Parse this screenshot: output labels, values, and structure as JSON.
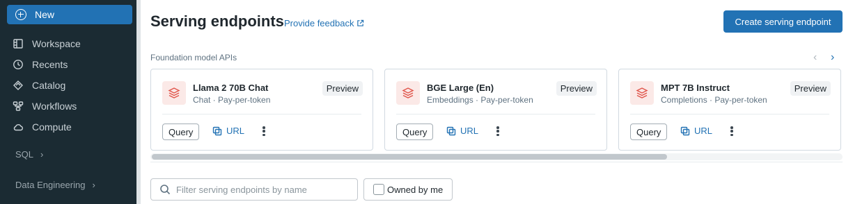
{
  "sidebar": {
    "new_label": "New",
    "items": [
      {
        "label": "Workspace",
        "icon": "workspace-icon"
      },
      {
        "label": "Recents",
        "icon": "clock-icon"
      },
      {
        "label": "Catalog",
        "icon": "catalog-icon"
      },
      {
        "label": "Workflows",
        "icon": "workflows-icon"
      },
      {
        "label": "Compute",
        "icon": "cloud-icon"
      }
    ],
    "sections": [
      {
        "label": "SQL"
      },
      {
        "label": "Data Engineering"
      }
    ]
  },
  "header": {
    "title": "Serving endpoints",
    "feedback_label": "Provide feedback",
    "create_label": "Create serving endpoint"
  },
  "foundation": {
    "heading": "Foundation model APIs",
    "cards": [
      {
        "name": "Llama 2 70B Chat",
        "meta": "Chat · Pay-per-token",
        "badge": "Preview",
        "query_label": "Query",
        "url_label": "URL"
      },
      {
        "name": "BGE Large (En)",
        "meta": "Embeddings · Pay-per-token",
        "badge": "Preview",
        "query_label": "Query",
        "url_label": "URL"
      },
      {
        "name": "MPT 7B Instruct",
        "meta": "Completions · Pay-per-token",
        "badge": "Preview",
        "query_label": "Query",
        "url_label": "URL"
      }
    ]
  },
  "filter": {
    "placeholder": "Filter serving endpoints by name",
    "owned_label": "Owned by me",
    "owned_checked": false
  },
  "colors": {
    "accent": "#2272b4",
    "sidebar_bg": "#1b2b33",
    "model_icon": "#e0554b"
  }
}
